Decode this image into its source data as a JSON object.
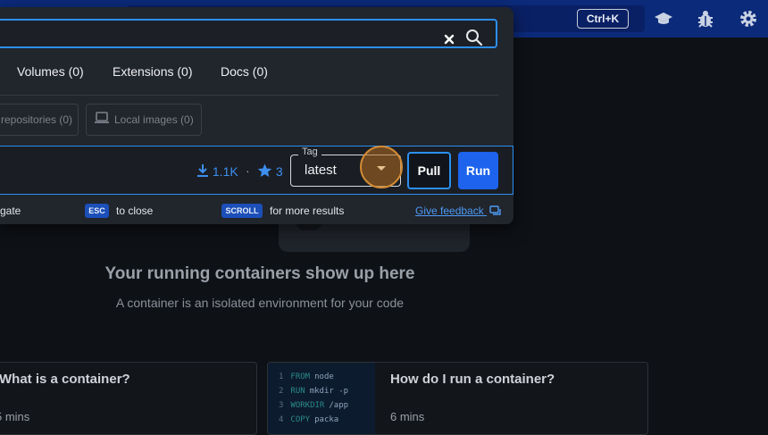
{
  "header": {
    "shortcut": "Ctrl+K",
    "icons": [
      "learning-center-icon",
      "troubleshoot-bug-icon",
      "settings-gear-icon"
    ]
  },
  "search": {
    "value": "",
    "tabs": [
      {
        "label": "Volumes (0)"
      },
      {
        "label": "Extensions (0)"
      },
      {
        "label": "Docs (0)"
      }
    ],
    "filters": [
      {
        "label": "repositories (0)"
      },
      {
        "label": "Local images (0)"
      }
    ],
    "result": {
      "downloads": "1.1K",
      "separator": "·",
      "stars": "3",
      "tag_label": "Tag",
      "tag_value": "latest",
      "pull_label": "Pull",
      "run_label": "Run"
    },
    "footer": {
      "navigate_text": "gate",
      "esc_key": "ESC",
      "esc_text": "to close",
      "scroll_key": "SCROLL",
      "scroll_text": "for more results",
      "feedback_link": "Give feedback"
    }
  },
  "main": {
    "empty_title": "Your running containers show up here",
    "empty_subtitle": "A container is an isolated environment for your code",
    "cards": [
      {
        "title": "What is a container?",
        "duration": "5 mins"
      },
      {
        "title": "How do I run a container?",
        "duration": "6 mins",
        "code": [
          {
            "n": "1",
            "kw": "FROM",
            "rest": "node"
          },
          {
            "n": "2",
            "kw": "RUN",
            "rest": "mkdir -p"
          },
          {
            "n": "3",
            "kw": "WORKDIR",
            "rest": "/app"
          },
          {
            "n": "4",
            "kw": "COPY",
            "rest": "packa"
          }
        ]
      }
    ]
  },
  "colors": {
    "accent": "#2c8ff0",
    "primary_button": "#1d63ed",
    "header_bg": "#0b2a7a",
    "focus_orange": "#d28a34"
  }
}
